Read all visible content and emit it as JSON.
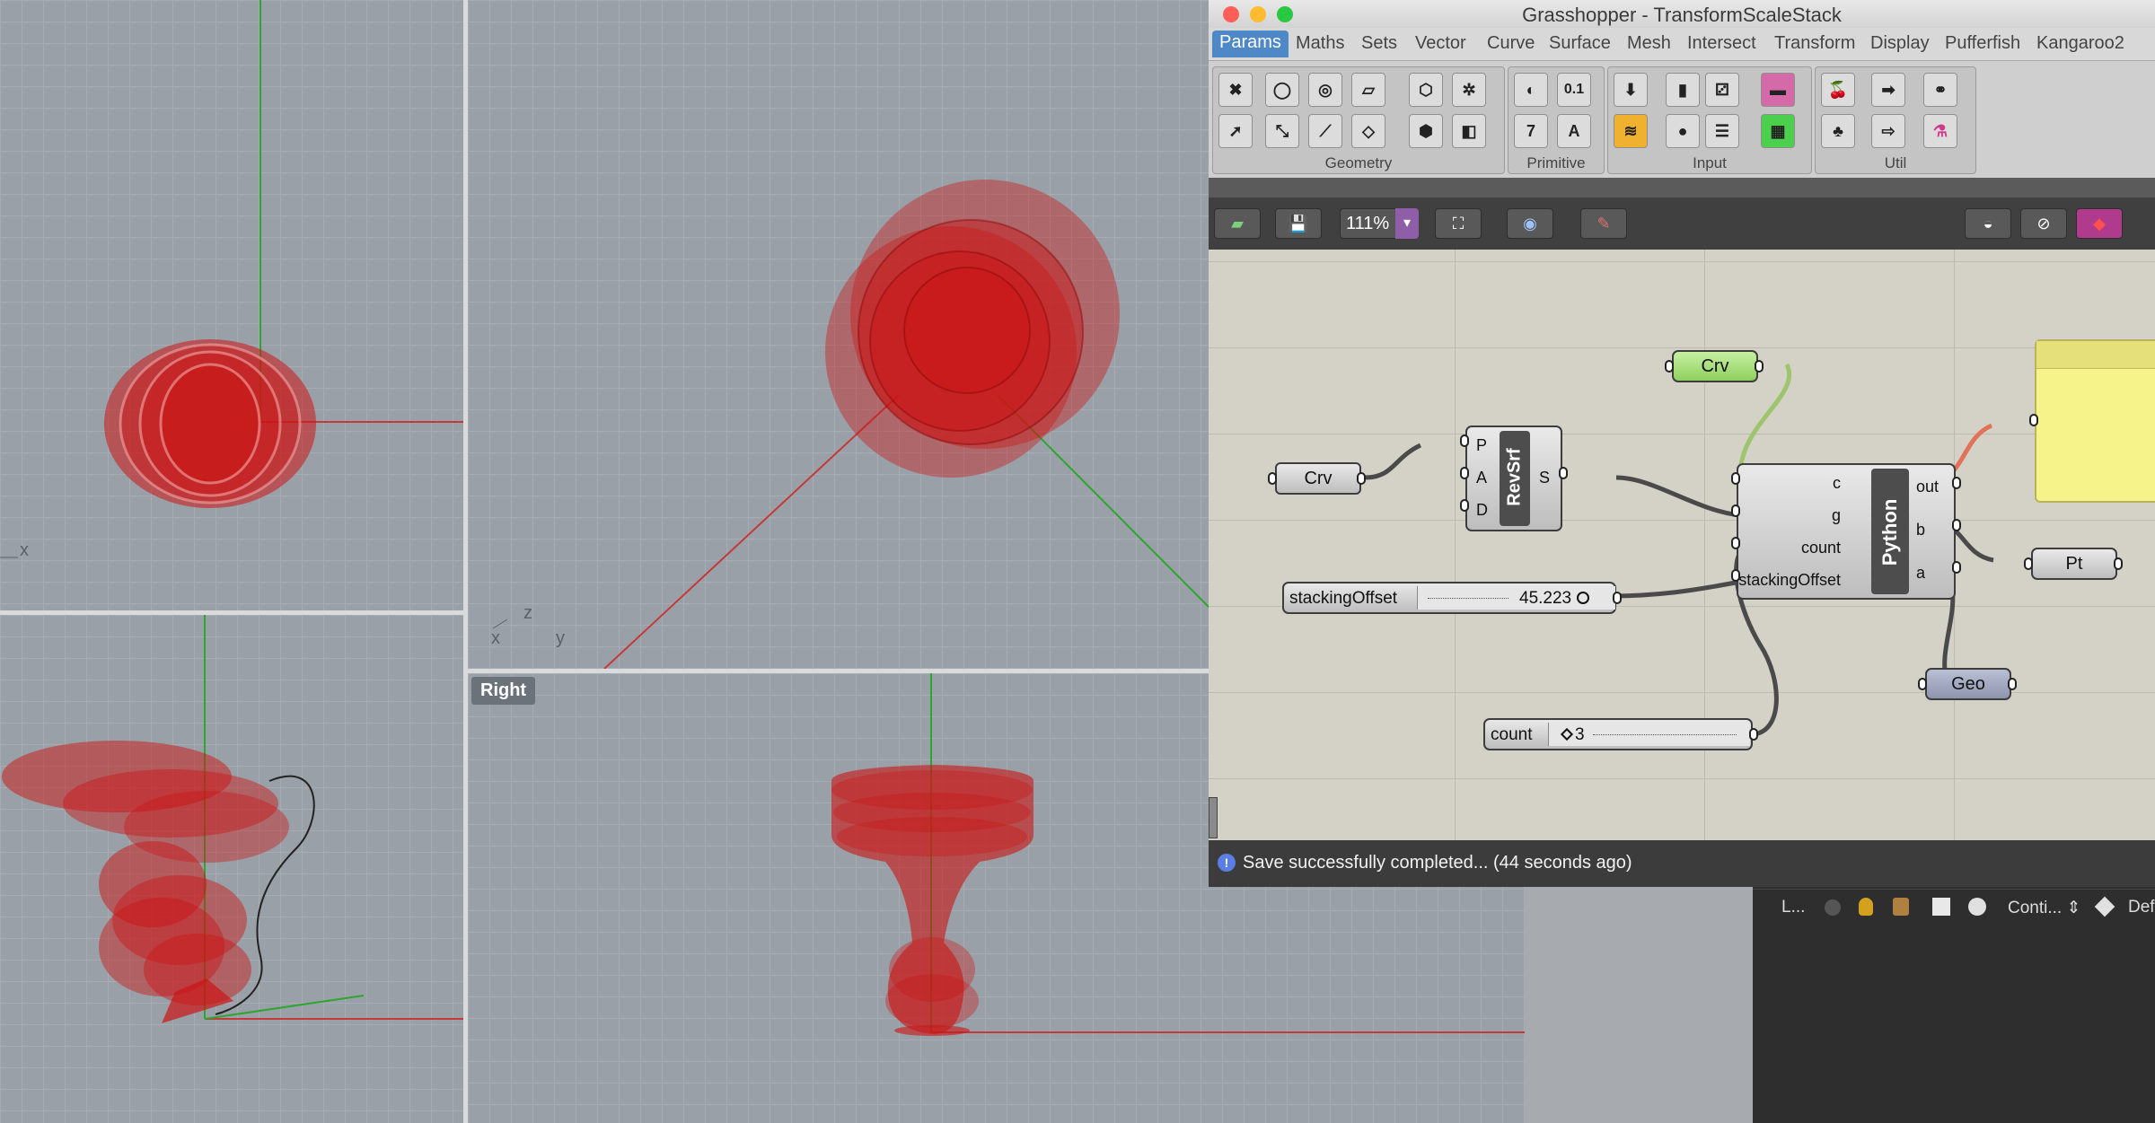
{
  "viewports": {
    "top_left": {
      "axis_label": "x"
    },
    "perspective": {
      "axis_labels": [
        "x",
        "z",
        "y"
      ]
    },
    "right": {
      "label": "Right"
    }
  },
  "gh_window": {
    "title": "Grasshopper - TransformScaleStack",
    "tabs": [
      "Params",
      "Maths",
      "Sets",
      "Vector",
      "Curve",
      "Surface",
      "Mesh",
      "Intersect",
      "Transform",
      "Display",
      "Pufferfish",
      "Kangaroo2"
    ],
    "active_tab": "Params",
    "ribbon_panels": [
      "Geometry",
      "Primitive",
      "Input",
      "Util"
    ],
    "primitive_icons": [
      "0.1",
      "7",
      "A"
    ],
    "zoom": "111%",
    "status_message": "Save successfully completed... (44 seconds ago)"
  },
  "canvas": {
    "crv_node_1": "Crv",
    "crv_node_2": "Crv",
    "revsrf": {
      "name": "RevSrf",
      "inputs": [
        "P",
        "A",
        "D"
      ],
      "output": "S"
    },
    "python": {
      "name": "Python",
      "inputs": [
        "c",
        "g",
        "count",
        "stackingOffset"
      ],
      "outputs": [
        "out",
        "b",
        "a"
      ]
    },
    "slider_offset": {
      "label": "stackingOffset",
      "value": "45.223"
    },
    "slider_count": {
      "label": "count",
      "value": "3"
    },
    "pt_node": "Pt",
    "geo_node": "Geo"
  },
  "layers_panel": {
    "row_label": "L...",
    "linetype": "Conti...",
    "print": "Def"
  },
  "colors": {
    "geometry_red": "#cc1414",
    "tab_active": "#4e88c6",
    "crv_param": "#a6e07a",
    "panel_yellow": "#f6f38a"
  }
}
